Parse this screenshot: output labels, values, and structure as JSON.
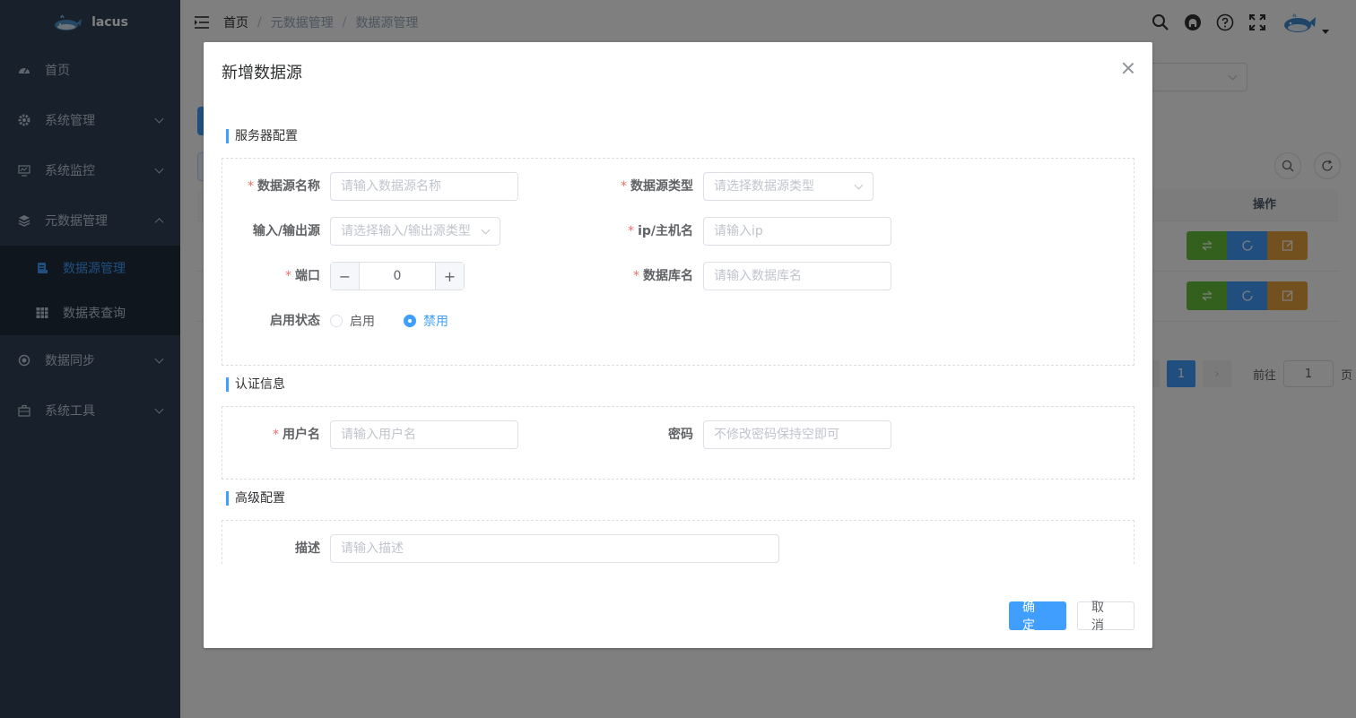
{
  "app": {
    "name": "lacus"
  },
  "sidebar": {
    "items": [
      {
        "label": "首页",
        "icon": "dashboard-icon"
      },
      {
        "label": "系统管理",
        "icon": "gear-icon"
      },
      {
        "label": "系统监控",
        "icon": "monitor-icon"
      },
      {
        "label": "元数据管理",
        "icon": "layers-icon",
        "expanded": true,
        "children": [
          {
            "label": "数据源管理",
            "icon": "database-icon",
            "active": true
          },
          {
            "label": "数据表查询",
            "icon": "table-icon"
          }
        ]
      },
      {
        "label": "数据同步",
        "icon": "sync-icon"
      },
      {
        "label": "系统工具",
        "icon": "toolbox-icon"
      }
    ]
  },
  "breadcrumb": [
    "首页",
    "元数据管理",
    "数据源管理"
  ],
  "background": {
    "table_ops_header": "操作",
    "pagination": {
      "current": "1",
      "goto_label": "前往",
      "goto_value": "1",
      "page_suffix": "页"
    }
  },
  "dialog": {
    "title": "新增数据源",
    "sections": {
      "server": {
        "title": "服务器配置",
        "datasource_name": {
          "label": "数据源名称",
          "placeholder": "请输入数据源名称"
        },
        "datasource_type": {
          "label": "数据源类型",
          "placeholder": "请选择数据源类型"
        },
        "io_source": {
          "label": "输入/输出源",
          "placeholder": "请选择输入/输出源类型"
        },
        "host": {
          "label": "ip/主机名",
          "placeholder": "请输入ip"
        },
        "port": {
          "label": "端口",
          "value": "0"
        },
        "database": {
          "label": "数据库名",
          "placeholder": "请输入数据库名"
        },
        "status": {
          "label": "启用状态",
          "options": [
            "启用",
            "禁用"
          ],
          "selected": "禁用"
        }
      },
      "auth": {
        "title": "认证信息",
        "username": {
          "label": "用户名",
          "placeholder": "请输入用户名"
        },
        "password": {
          "label": "密码",
          "placeholder": "不修改密码保持空即可"
        }
      },
      "advanced": {
        "title": "高级配置",
        "description": {
          "label": "描述",
          "placeholder": "请输入描述"
        }
      }
    },
    "footer": {
      "confirm": "确 定",
      "cancel": "取 消"
    }
  },
  "colors": {
    "primary": "#409eff",
    "sidebar": "#304156",
    "danger": "#f56c6c",
    "success": "#67c23a",
    "warning": "#e6a23c"
  }
}
